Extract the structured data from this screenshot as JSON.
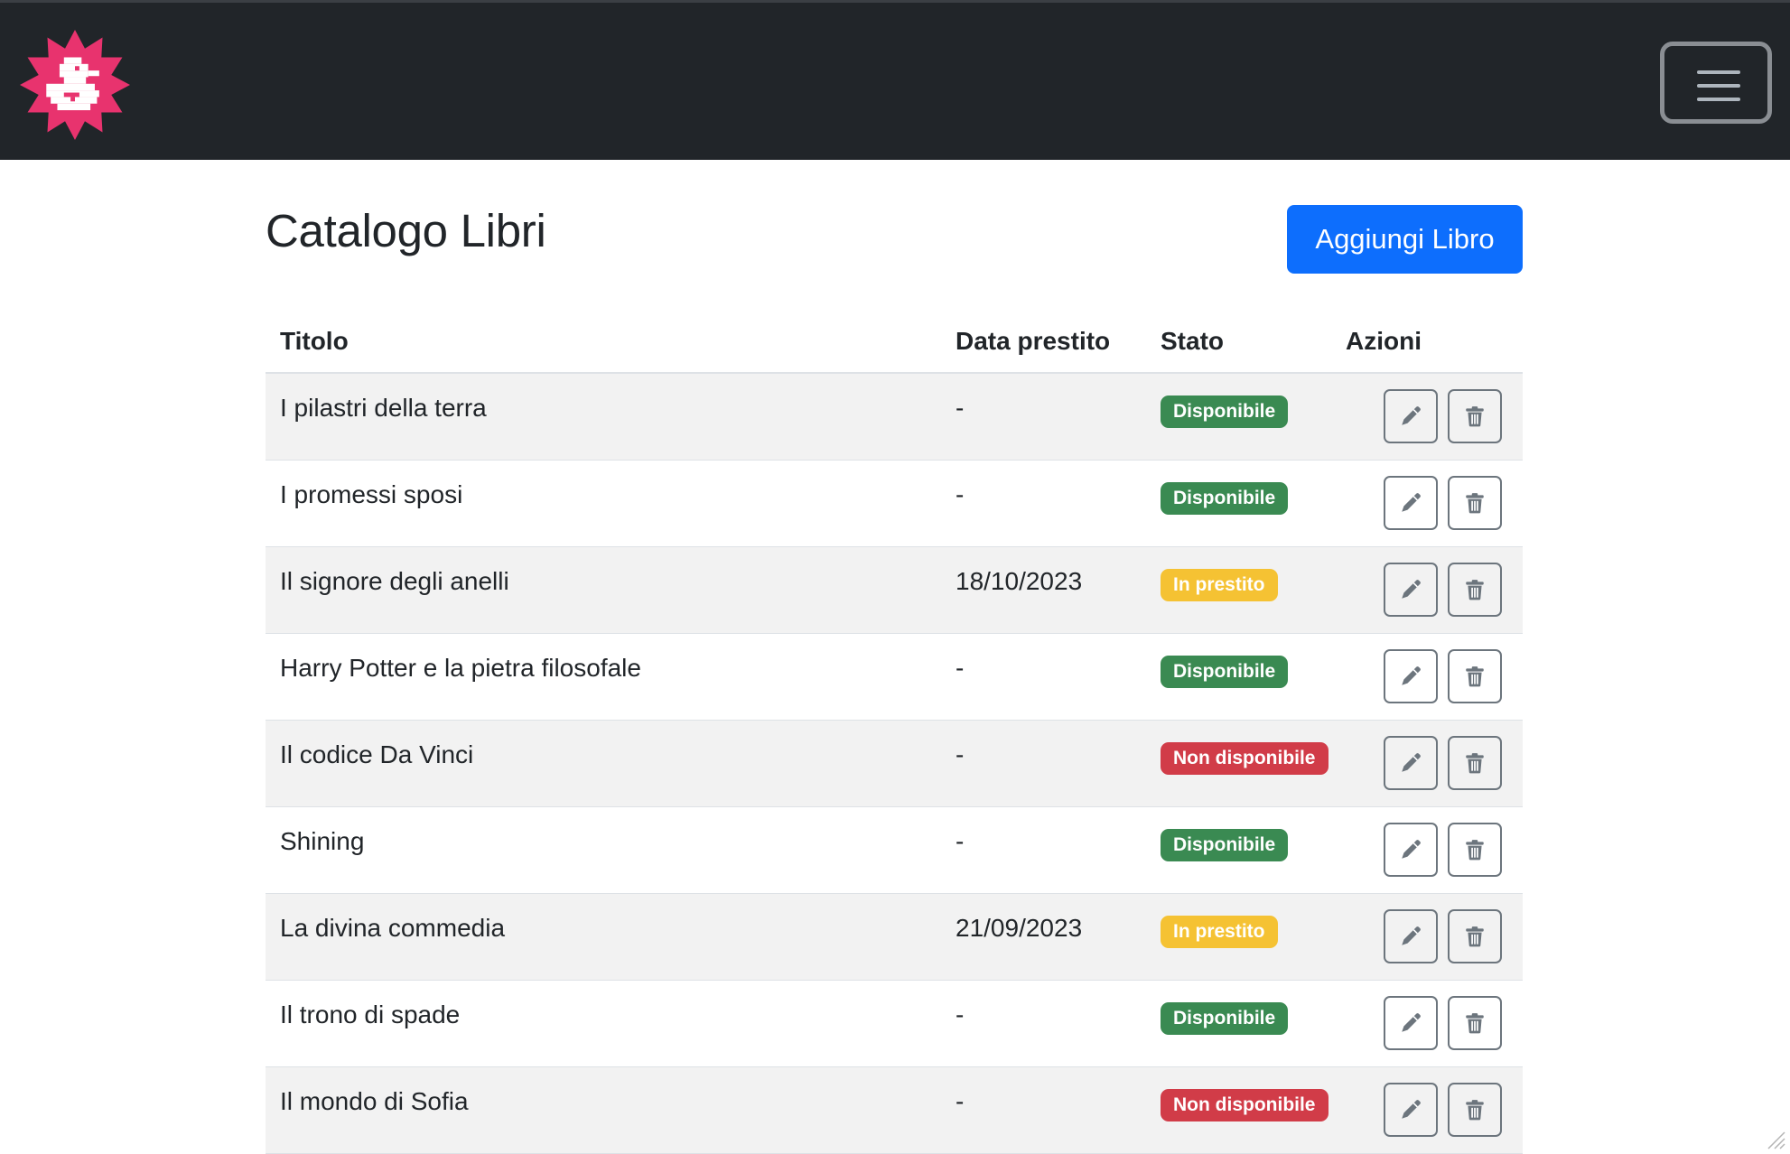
{
  "navbar": {
    "logo_icon": "duck-sun-logo-icon",
    "menu_icon": "hamburger-menu-icon"
  },
  "page": {
    "title": "Catalogo Libri",
    "add_button": "Aggiungi Libro"
  },
  "table": {
    "headers": {
      "title": "Titolo",
      "date": "Data prestito",
      "status": "Stato",
      "actions": "Azioni"
    },
    "rows": [
      {
        "title": "I pilastri della terra",
        "date": "-",
        "status": "Disponibile"
      },
      {
        "title": "I promessi sposi",
        "date": "-",
        "status": "Disponibile"
      },
      {
        "title": "Il signore degli anelli",
        "date": "18/10/2023",
        "status": "In prestito"
      },
      {
        "title": "Harry Potter e la pietra filosofale",
        "date": "-",
        "status": "Disponibile"
      },
      {
        "title": "Il codice Da Vinci",
        "date": "-",
        "status": "Non disponibile"
      },
      {
        "title": "Shining",
        "date": "-",
        "status": "Disponibile"
      },
      {
        "title": "La divina commedia",
        "date": "21/09/2023",
        "status": "In prestito"
      },
      {
        "title": "Il trono di spade",
        "date": "-",
        "status": "Disponibile"
      },
      {
        "title": "Il mondo di Sofia",
        "date": "-",
        "status": "Non disponibile"
      }
    ],
    "action_icons": {
      "edit": "pencil-icon",
      "delete": "trash-icon"
    }
  },
  "colors": {
    "navbar": "#212529",
    "primary": "#0d6efd",
    "logo": "#e8336e",
    "status_available": "#3a8a52",
    "status_on_loan": "#f5c233",
    "status_unavailable": "#d13c48"
  }
}
